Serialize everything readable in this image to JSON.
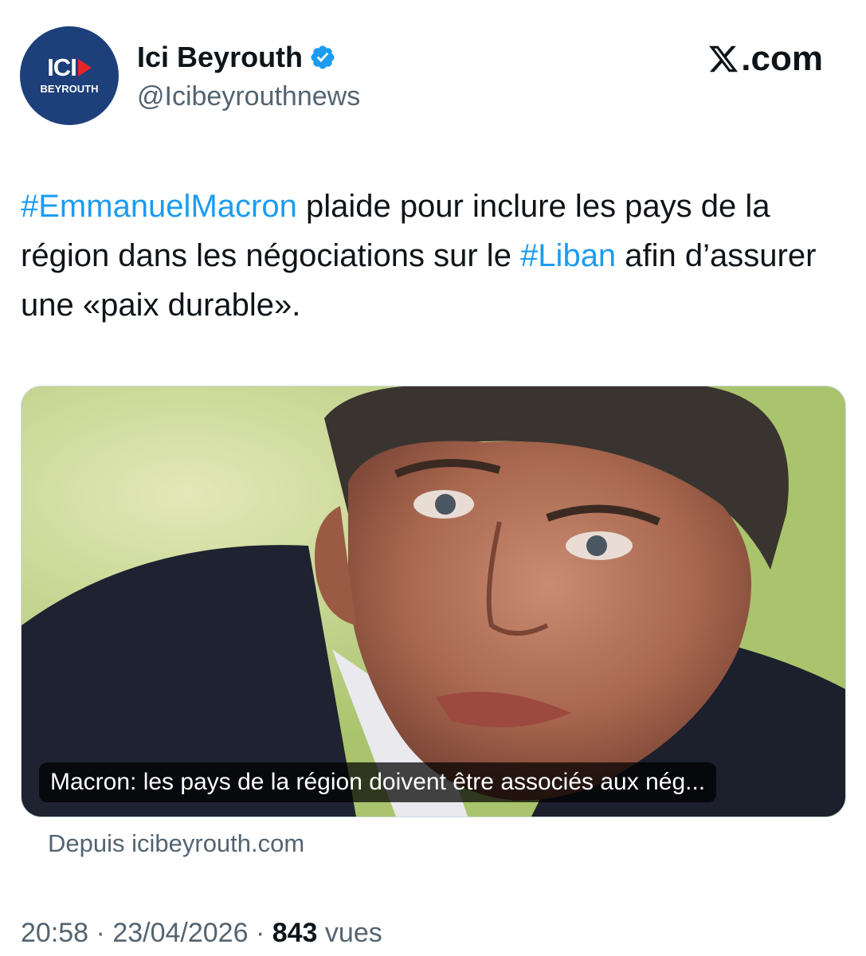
{
  "account": {
    "logo_text": "ICI",
    "logo_subtext": "BEYROUTH",
    "display_name": "Ici Beyrouth",
    "handle": "@Icibeyrouthnews",
    "verified": true
  },
  "brand": {
    "site": ".com"
  },
  "tweet": {
    "hashtag1": "#EmmanuelMacron",
    "text1": " plaide pour inclure les pays de la région dans les négociations sur le ",
    "hashtag2": "#Liban",
    "text2": " afin d’assurer une «paix durable»."
  },
  "card": {
    "caption": "Macron: les pays de la région doivent être associés aux nég...",
    "source": "Depuis icibeyrouth.com"
  },
  "meta": {
    "time": "20:58",
    "separator": "·",
    "date": "23/04/2026",
    "views_count": "843",
    "views_label": "vues"
  },
  "colors": {
    "accent": "#1d9bf0",
    "secondary_text": "#536471",
    "logo_bg": "#1d3f7a",
    "logo_play": "#e5262b"
  }
}
